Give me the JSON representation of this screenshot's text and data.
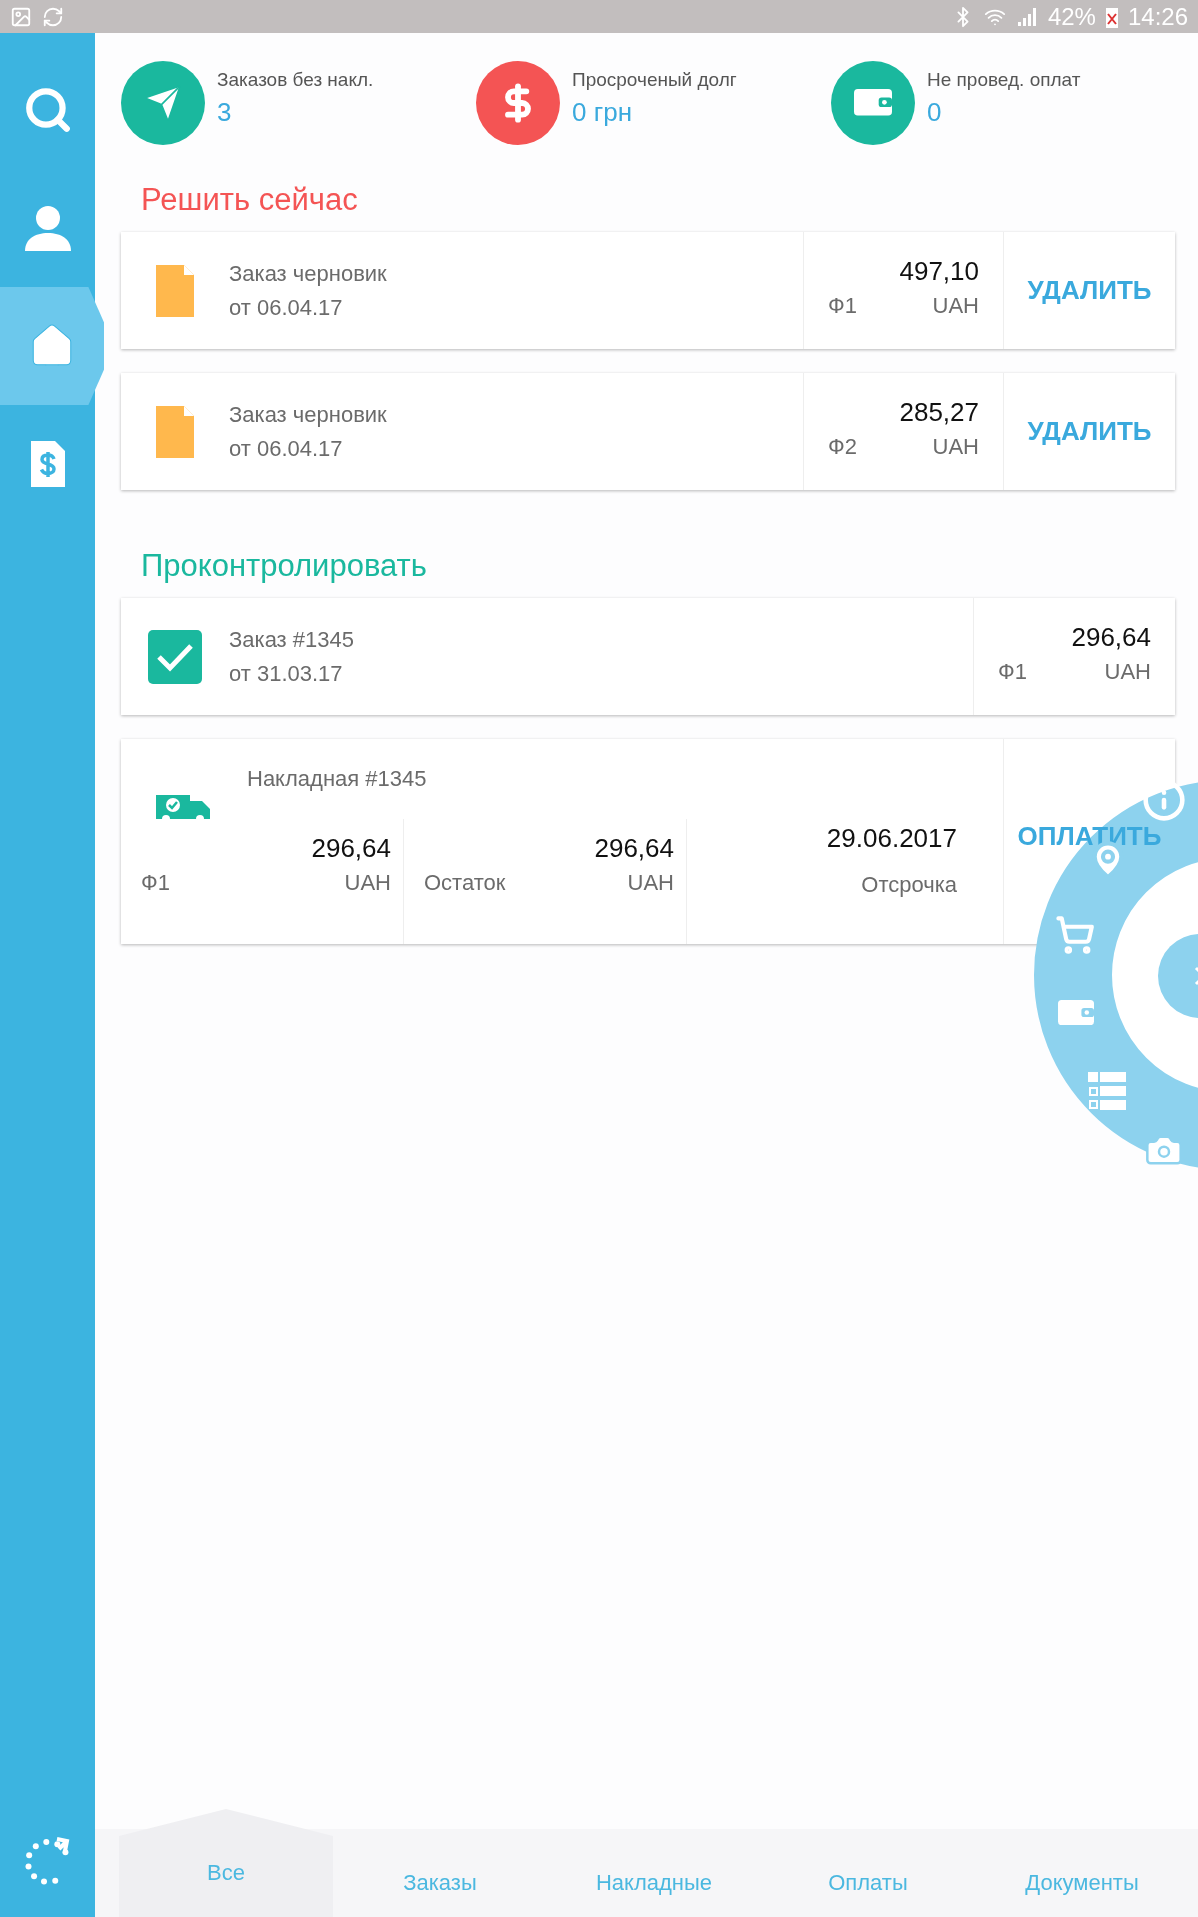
{
  "status_bar": {
    "battery": "42%",
    "time": "14:26"
  },
  "sidebar": {
    "items": [
      {
        "kind": "search",
        "selected": false
      },
      {
        "kind": "profile",
        "selected": false
      },
      {
        "kind": "home",
        "selected": true
      },
      {
        "kind": "invoice",
        "selected": false
      }
    ]
  },
  "stats": [
    {
      "kind": "send",
      "color": "#1ab89e",
      "label": "Заказов без накл.",
      "value": "3"
    },
    {
      "kind": "dollar",
      "color": "#f45454",
      "label": "Просроченый долг",
      "value": "0 грн"
    },
    {
      "kind": "wallet",
      "color": "#1ab89e",
      "label": "Не провед. оплат",
      "value": "0"
    }
  ],
  "sections": [
    {
      "title": "Решить сейчас",
      "color": "#f45454",
      "cards": [
        {
          "kind": "draft",
          "title": "Заказ черновик",
          "date": "от 06.04.17",
          "amount": "497,10",
          "firm": "Ф1",
          "currency": "UAH",
          "action": "УДАЛИТЬ"
        },
        {
          "kind": "draft",
          "title": "Заказ черновик",
          "date": "от 06.04.17",
          "amount": "285,27",
          "firm": "Ф2",
          "currency": "UAH",
          "action": "УДАЛИТЬ"
        }
      ]
    },
    {
      "title": "Проконтролировать",
      "color": "#1ab89e",
      "cards": [
        {
          "kind": "order",
          "checked": true,
          "title": "Заказ #1345",
          "date": "от 31.03.17",
          "amount": "296,64",
          "firm": "Ф1",
          "currency": "UAH"
        },
        {
          "kind": "waybill",
          "title": "Накладная #1345",
          "cells": [
            {
              "label": "Ф1",
              "amount": "296,64",
              "currency": "UAH"
            },
            {
              "label": "Остаток",
              "amount": "296,64",
              "currency": "UAH"
            }
          ],
          "date": "29.06.2017",
          "date_label": "Отсрочка",
          "action": "ОПЛАТИТЬ"
        }
      ]
    }
  ],
  "radial_menu": {
    "items": [
      {
        "kind": "info"
      },
      {
        "kind": "pin"
      },
      {
        "kind": "cart"
      },
      {
        "kind": "wallet"
      },
      {
        "kind": "table"
      },
      {
        "kind": "camera"
      }
    ]
  },
  "tabs": [
    {
      "label": "Все",
      "selected": true
    },
    {
      "label": "Заказы",
      "selected": false
    },
    {
      "label": "Накладные",
      "selected": false
    },
    {
      "label": "Оплаты",
      "selected": false
    },
    {
      "label": "Документы",
      "selected": false
    }
  ]
}
